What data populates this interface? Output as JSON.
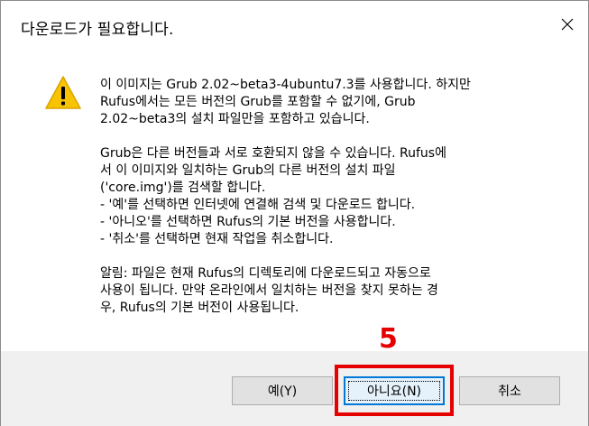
{
  "dialog": {
    "title": "다운로드가 필요합니다.",
    "close_icon": "close-icon",
    "warning_icon": "warning-icon",
    "message": {
      "para1": [
        "이 이미지는 Grub 2.02~beta3-4ubuntu7.3를 사용합니다. 하지만",
        "Rufus에서는 모든 버전의 Grub를 포함할 수 없기에, Grub",
        "2.02~beta3의 설치 파일만을 포함하고 있습니다."
      ],
      "para2": [
        "Grub은 다른 버전들과 서로 호환되지 않을 수 있습니다. Rufus에",
        "서 이 이미지와 일치하는 Grub의 다른 버전의 설치 파일",
        "('core.img')를 검색할 합니다.",
        "- '예'를 선택하면 인터넷에 연결해 검색 및 다운로드 합니다.",
        "- '아니오'를 선택하면 Rufus의 기본 버전을 사용합니다.",
        "- '취소'를 선택하면 현재 작업을 취소합니다."
      ],
      "para3": [
        "알림: 파일은 현재 Rufus의 디렉토리에 다운로드되고 자동으로",
        "사용이 됩니다. 만약 온라인에서 일치하는 버전을 찾지 못하는 경",
        "우, Rufus의 기본 버전이 사용됩니다."
      ]
    },
    "buttons": {
      "yes": "예(Y)",
      "no": "아니요(N)",
      "cancel": "취소"
    }
  },
  "annotation": {
    "step_number": "5",
    "color": "#e60000"
  }
}
